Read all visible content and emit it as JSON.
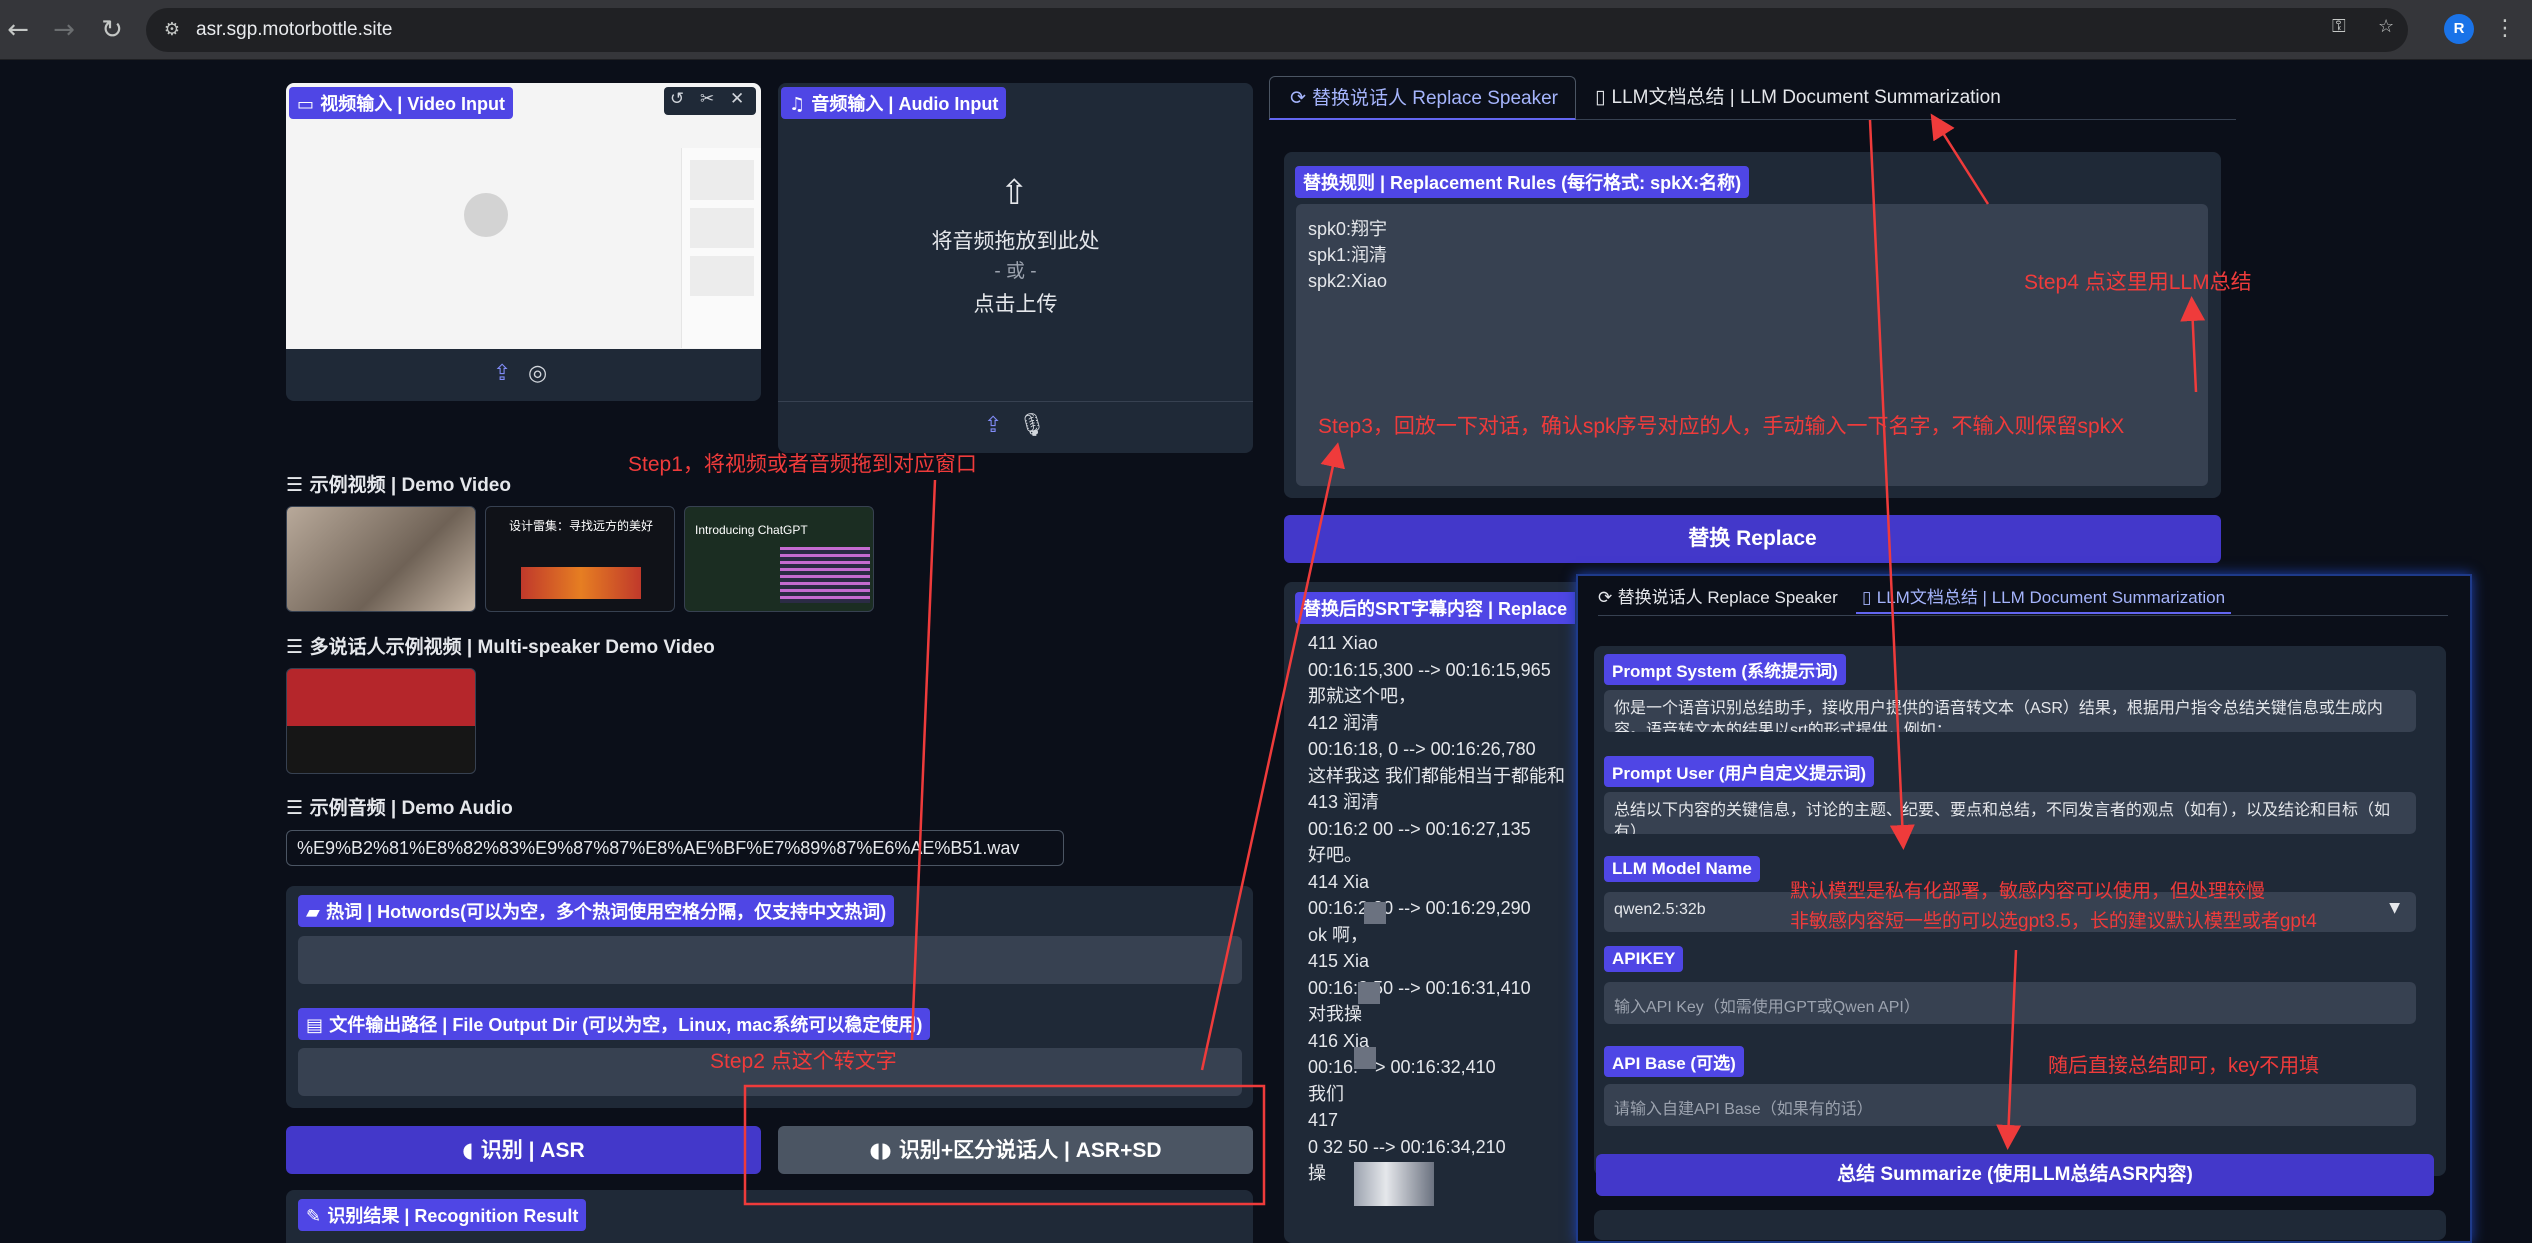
{
  "browser": {
    "url": "asr.sgp.motorbottle.site",
    "profile_initial": "R"
  },
  "video_input": {
    "label": "视频输入 | Video Input"
  },
  "audio_input": {
    "label": "音频输入 | Audio Input",
    "drop_text": "将音频拖放到此处",
    "or_text": "- 或 -",
    "click_text": "点击上传"
  },
  "demo_video": {
    "title": "示例视频 | Demo Video",
    "thumb2_text": "设计雷集：寻找远方的美好",
    "thumb3_text": "Introducing ChatGPT"
  },
  "multi_demo": {
    "title": "多说话人示例视频 | Multi-speaker Demo Video"
  },
  "demo_audio": {
    "title": "示例音频 | Demo Audio",
    "file": "%E9%B2%81%E8%82%83%E9%87%87%E8%AE%BF%E7%89%87%E6%AE%B51.wav"
  },
  "hotwords": {
    "label": "热词 | Hotwords(可以为空，多个热词使用空格分隔，仅支持中文热词)"
  },
  "output_dir": {
    "label": "文件输出路径 | File Output Dir (可以为空，Linux, mac系统可以稳定使用)"
  },
  "buttons": {
    "asr": "识别 | ASR",
    "asr_sd": "识别+区分说话人 | ASR+SD",
    "replace": "替换 Replace",
    "summarize": "总结 Summarize (使用LLM总结ASR内容)"
  },
  "recognition_result": {
    "label": "识别结果 | Recognition Result"
  },
  "tabs": {
    "replace_speaker": "替换说话人 Replace Speaker",
    "llm_summary": "LLM文档总结 | LLM Document Summarization"
  },
  "replace_rules": {
    "label": "替换规则 | Replacement Rules (每行格式: spkX:名称)",
    "lines": [
      "spk0:翔宇",
      "spk1:润清",
      "spk2:Xiao"
    ]
  },
  "srt": {
    "label": "替换后的SRT字幕内容 | Replace",
    "lines": [
      "411  Xiao",
      "00:16:15,300 --> 00:16:15,965",
      "那就这个吧，",
      "412  润清",
      "00:16:18,  0 --> 00:16:26,780",
      "这样我这  我们都能相当于都能和",
      "413  润清",
      "00:16:2   00 --> 00:16:27,135",
      "好吧。",
      "414  Xia",
      "00:16:2   00 --> 00:16:29,290",
      " ok 啊，",
      "415  Xia",
      "00:16:2   50 --> 00:16:31,410",
      "对我操",
      "416  Xia",
      "00:16:    --> 00:16:32,410",
      "我们",
      "417  ",
      "0    32   50 --> 00:16:34,210",
      "操  "
    ]
  },
  "overlay": {
    "tab_replace": "替换说话人 Replace Speaker",
    "tab_llm": "LLM文档总结 | LLM Document Summarization",
    "prompt_system_label": "Prompt System (系统提示词)",
    "prompt_system_value": "你是一个语音识别总结助手，接收用户提供的语音转文本（ASR）结果，根据用户指令总结关键信息或生成内容。语音转文本的结果以srt的形式提供，例如：",
    "prompt_user_label": "Prompt User (用户自定义提示词)",
    "prompt_user_value": "总结以下内容的关键信息，讨论的主题、纪要、要点和总结，不同发言者的观点（如有），以及结论和目标（如有）",
    "model_label": "LLM Model Name",
    "model_value": "qwen2.5:32b",
    "apikey_label": "APIKEY",
    "apikey_placeholder": "输入API Key（如需使用GPT或Qwen API）",
    "apibase_label": "API Base (可选)",
    "apibase_placeholder": "请输入自建API Base（如果有的话）"
  },
  "annotations": {
    "step1": "Step1，将视频或者音频拖到对应窗口",
    "step2": "Step2 点这个转文字",
    "step3": "Step3，回放一下对话，确认spk序号对应的人，手动输入一下名字，不输入则保留spkX",
    "step4": "Step4 点这里用LLM总结",
    "model_note1": "默认模型是私有化部署，敏感内容可以使用，但处理较慢",
    "model_note2": "非敏感内容短一些的可以选gpt3.5，长的建议默认模型或者gpt4",
    "final_note": "随后直接总结即可，key不用填"
  },
  "colors": {
    "annotation": "#ef3b3b",
    "accent": "#4f46e5",
    "background": "#0b0f19"
  }
}
